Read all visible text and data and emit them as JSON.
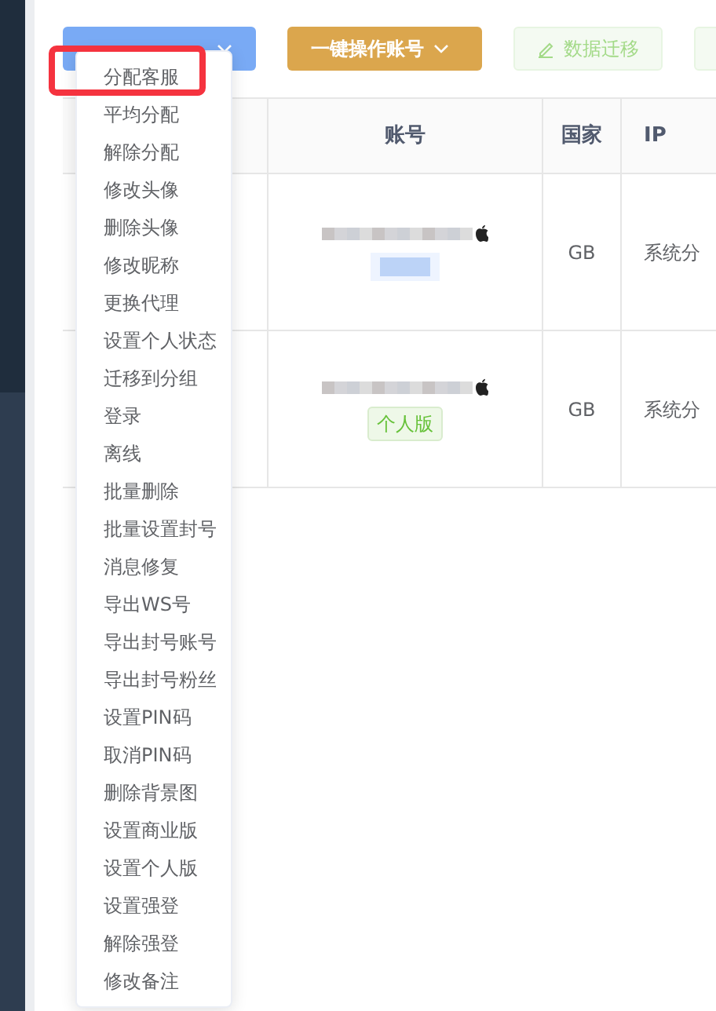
{
  "toolbar": {
    "buttons": [
      {
        "kind": "primary"
      },
      {
        "kind": "warning",
        "label": "一键操作账号"
      },
      {
        "kind": "plain",
        "label": "数据迁移",
        "disabled": true
      },
      {
        "kind": "plain-cut",
        "disabled": true
      }
    ]
  },
  "table": {
    "columns": [
      "账号",
      "国家",
      "IP"
    ],
    "rows": [
      {
        "tag": {
          "kind": "redacted"
        },
        "country": "GB",
        "ip": "系统分"
      },
      {
        "tag": {
          "kind": "label",
          "text": "个人版"
        },
        "country": "GB",
        "ip": "系统分"
      }
    ]
  },
  "menu": {
    "items": [
      {
        "label": "分配客服",
        "highlighted": true
      },
      {
        "label": "平均分配",
        "highlighted": false
      },
      {
        "label": "解除分配",
        "highlighted": false
      },
      {
        "label": "修改头像",
        "highlighted": false
      },
      {
        "label": "删除头像",
        "highlighted": false
      },
      {
        "label": "修改昵称",
        "highlighted": false
      },
      {
        "label": "更换代理",
        "highlighted": false
      },
      {
        "label": "设置个人状态",
        "highlighted": false
      },
      {
        "label": "迁移到分组",
        "highlighted": false
      },
      {
        "label": "登录",
        "highlighted": false
      },
      {
        "label": "离线",
        "highlighted": false
      },
      {
        "label": "批量删除",
        "highlighted": false
      },
      {
        "label": "批量设置封号",
        "highlighted": false
      },
      {
        "label": "消息修复",
        "highlighted": false
      },
      {
        "label": "导出WS号",
        "highlighted": false
      },
      {
        "label": "导出封号账号",
        "highlighted": false
      },
      {
        "label": "导出封号粉丝",
        "highlighted": false
      },
      {
        "label": "设置PIN码",
        "highlighted": false
      },
      {
        "label": "取消PIN码",
        "highlighted": false
      },
      {
        "label": "删除背景图",
        "highlighted": false
      },
      {
        "label": "设置商业版",
        "highlighted": false
      },
      {
        "label": "设置个人版",
        "highlighted": false
      },
      {
        "label": "设置强登",
        "highlighted": false
      },
      {
        "label": "解除强登",
        "highlighted": false
      },
      {
        "label": "修改备注",
        "highlighted": false
      }
    ]
  }
}
